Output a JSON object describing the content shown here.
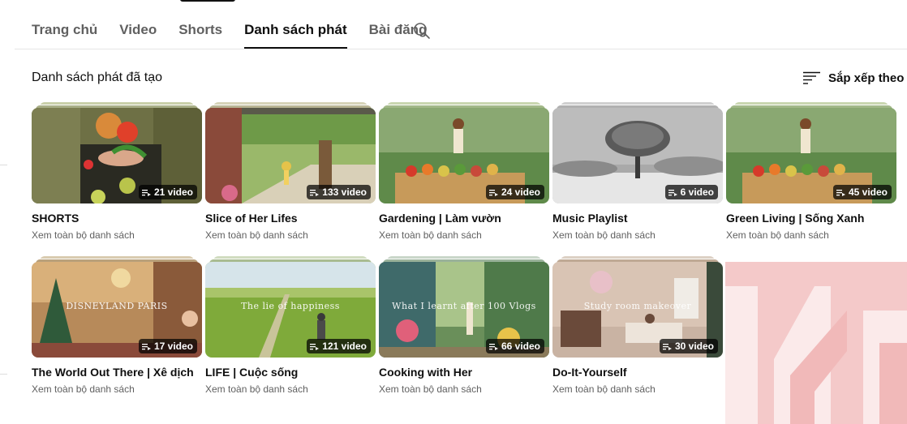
{
  "tabs": [
    {
      "label": "Trang chủ",
      "active": false
    },
    {
      "label": "Video",
      "active": false
    },
    {
      "label": "Shorts",
      "active": false
    },
    {
      "label": "Danh sách phát",
      "active": true
    },
    {
      "label": "Bài đăng",
      "active": false
    }
  ],
  "search_icon": "search-icon",
  "section": {
    "title": "Danh sách phát đã tạo",
    "sort_label": "Sắp xếp theo",
    "sort_icon": "sort-icon"
  },
  "playlists": [
    {
      "title": "SHORTS",
      "count": "21 video",
      "link": "Xem toàn bộ danh sách",
      "overlay": ""
    },
    {
      "title": "Slice of Her Lifes",
      "count": "133 video",
      "link": "Xem toàn bộ danh sách",
      "overlay": ""
    },
    {
      "title": "Gardening | Làm vườn",
      "count": "24 video",
      "link": "Xem toàn bộ danh sách",
      "overlay": ""
    },
    {
      "title": "Music Playlist",
      "count": "6 video",
      "link": "Xem toàn bộ danh sách",
      "overlay": ""
    },
    {
      "title": "Green Living | Sống Xanh",
      "count": "45 video",
      "link": "Xem toàn bộ danh sách",
      "overlay": ""
    },
    {
      "title": "The World Out There | Xê dịch",
      "count": "17 video",
      "link": "Xem toàn bộ danh sách",
      "overlay": "DISNEYLAND PARIS"
    },
    {
      "title": "LIFE | Cuộc sống",
      "count": "121 video",
      "link": "Xem toàn bộ danh sách",
      "overlay": "The lie of happiness"
    },
    {
      "title": "Cooking with Her",
      "count": "66 video",
      "link": "Xem toàn bộ danh sách",
      "overlay": "What I learnt after 100 Vlogs"
    },
    {
      "title": "Do-It-Yourself",
      "count": "30 video",
      "link": "Xem toàn bộ danh sách",
      "overlay": "Study room makeover"
    }
  ],
  "colors": {
    "accent": "#0f0f0f",
    "secondary_text": "#606060",
    "watermark": "#f4c9c9"
  }
}
